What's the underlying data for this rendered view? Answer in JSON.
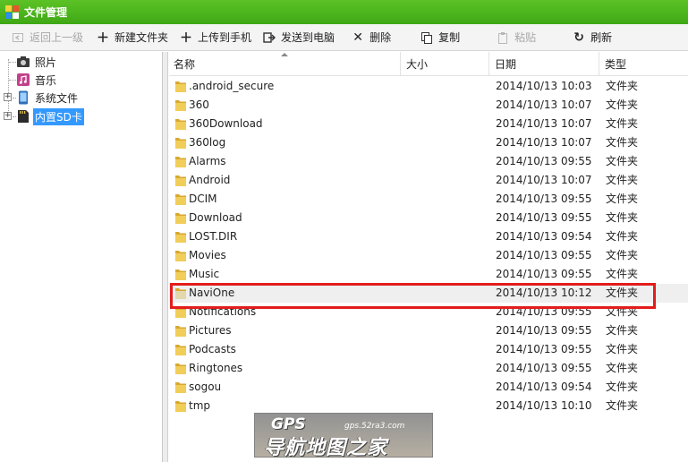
{
  "window": {
    "title": "文件管理"
  },
  "toolbar": {
    "back": "返回上一级",
    "new_folder": "新建文件夹",
    "upload": "上传到手机",
    "send_to_pc": "发送到电脑",
    "delete": "删除",
    "copy": "复制",
    "paste": "粘贴",
    "refresh": "刷新"
  },
  "tree": {
    "items": [
      {
        "label": "照片",
        "icon": "camera-icon"
      },
      {
        "label": "音乐",
        "icon": "music-icon"
      },
      {
        "label": "系统文件",
        "icon": "phone-icon"
      },
      {
        "label": "内置SD卡",
        "icon": "sdcard-icon",
        "selected": true
      }
    ]
  },
  "list": {
    "columns": {
      "name": "名称",
      "size": "大小",
      "date": "日期",
      "type": "类型"
    },
    "rows": [
      {
        "name": ".android_secure",
        "date": "2014/10/13 10:03",
        "type": "文件夹"
      },
      {
        "name": "360",
        "date": "2014/10/13 10:07",
        "type": "文件夹"
      },
      {
        "name": "360Download",
        "date": "2014/10/13 10:07",
        "type": "文件夹"
      },
      {
        "name": "360log",
        "date": "2014/10/13 10:07",
        "type": "文件夹"
      },
      {
        "name": "Alarms",
        "date": "2014/10/13 09:55",
        "type": "文件夹"
      },
      {
        "name": "Android",
        "date": "2014/10/13 10:07",
        "type": "文件夹"
      },
      {
        "name": "DCIM",
        "date": "2014/10/13 09:55",
        "type": "文件夹"
      },
      {
        "name": "Download",
        "date": "2014/10/13 09:55",
        "type": "文件夹"
      },
      {
        "name": "LOST.DIR",
        "date": "2014/10/13 09:54",
        "type": "文件夹"
      },
      {
        "name": "Movies",
        "date": "2014/10/13 09:55",
        "type": "文件夹"
      },
      {
        "name": "Music",
        "date": "2014/10/13 09:55",
        "type": "文件夹"
      },
      {
        "name": "NaviOne",
        "date": "2014/10/13 10:12",
        "type": "文件夹",
        "selected": true
      },
      {
        "name": "Notifications",
        "date": "2014/10/13 09:55",
        "type": "文件夹"
      },
      {
        "name": "Pictures",
        "date": "2014/10/13 09:55",
        "type": "文件夹"
      },
      {
        "name": "Podcasts",
        "date": "2014/10/13 09:55",
        "type": "文件夹"
      },
      {
        "name": "Ringtones",
        "date": "2014/10/13 09:55",
        "type": "文件夹"
      },
      {
        "name": "sogou",
        "date": "2014/10/13 09:54",
        "type": "文件夹"
      },
      {
        "name": "tmp",
        "date": "2014/10/13 10:10",
        "type": "文件夹"
      }
    ]
  },
  "watermark": {
    "brand": "GPS",
    "url": "gps.52ra3.com",
    "slogan": "导航地图之家"
  },
  "colors": {
    "titlebar": "#4cb51c",
    "selection": "#3399ff",
    "highlight_box": "#e31c1c",
    "folder": "#e9c04d"
  }
}
